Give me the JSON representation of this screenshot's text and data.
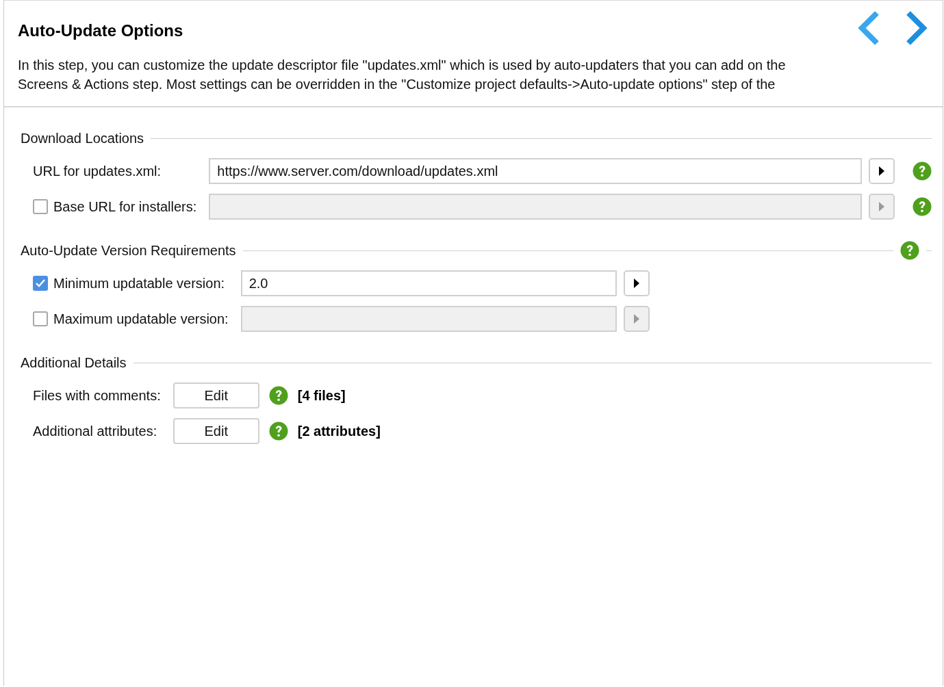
{
  "header": {
    "title": "Auto-Update Options",
    "description": "In this step, you can customize the update descriptor file \"updates.xml\" which is used by auto-updaters that you can add on the Screens & Actions step. Most settings can be overridden in the \"Customize project defaults->Auto-update options\" step of the",
    "nav": [
      {
        "kind": "back"
      },
      {
        "kind": "forward"
      }
    ]
  },
  "sections": [
    {
      "title": "Download Locations",
      "help": false,
      "rows": [
        {
          "kind": "field",
          "label": "URL for updates.xml:",
          "value": "https://www.server.com/download/updates.xml",
          "help": true
        },
        {
          "kind": "field",
          "label": "Base URL for installers:",
          "checked": false,
          "help": true
        }
      ]
    },
    {
      "title": "Auto-Update Version Requirements",
      "help": true,
      "rows": [
        {
          "kind": "field",
          "label": "Minimum updatable version:",
          "value": "2.0",
          "checked": true,
          "help": false
        },
        {
          "kind": "field",
          "label": "Maximum updatable version:",
          "checked": false,
          "help": false
        }
      ]
    },
    {
      "title": "Additional Details",
      "help": false,
      "rows": [
        {
          "kind": "edit",
          "label": "Files with comments:",
          "button": "Edit",
          "help": true,
          "summary": "[4 files]"
        },
        {
          "kind": "edit",
          "label": "Additional attributes:",
          "button": "Edit",
          "help": true,
          "summary": "[2 attributes]"
        }
      ]
    }
  ]
}
